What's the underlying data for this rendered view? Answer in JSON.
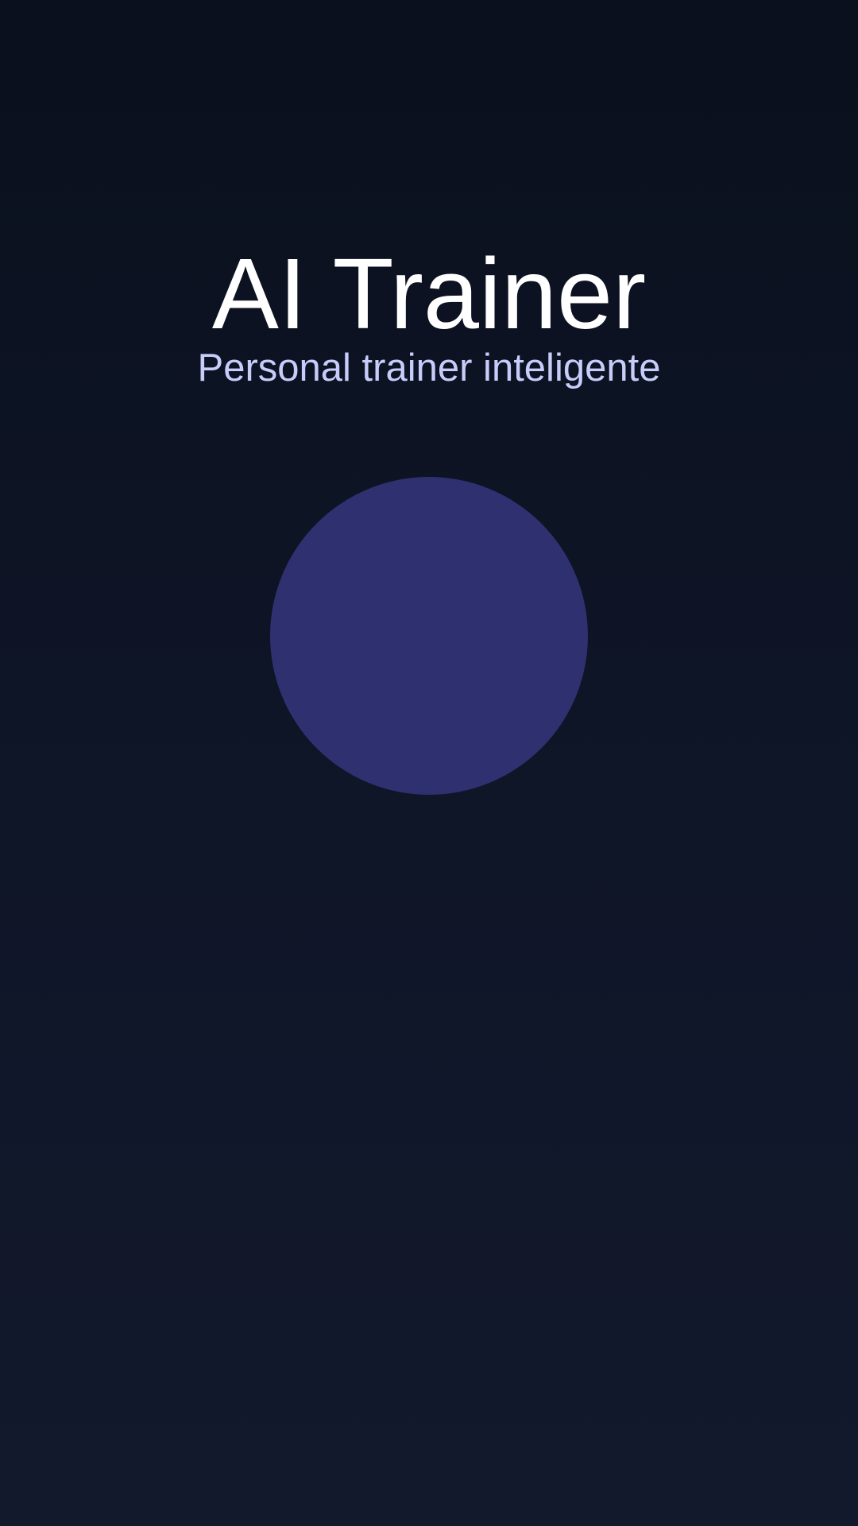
{
  "app": {
    "title": "AI Trainer",
    "subtitle": "Personal trainer inteligente"
  },
  "colors": {
    "background_top": "#0a101d",
    "background_bottom": "#13192c",
    "title": "#ffffff",
    "subtitle": "#c7cdfb",
    "circle": "#2f3070"
  }
}
